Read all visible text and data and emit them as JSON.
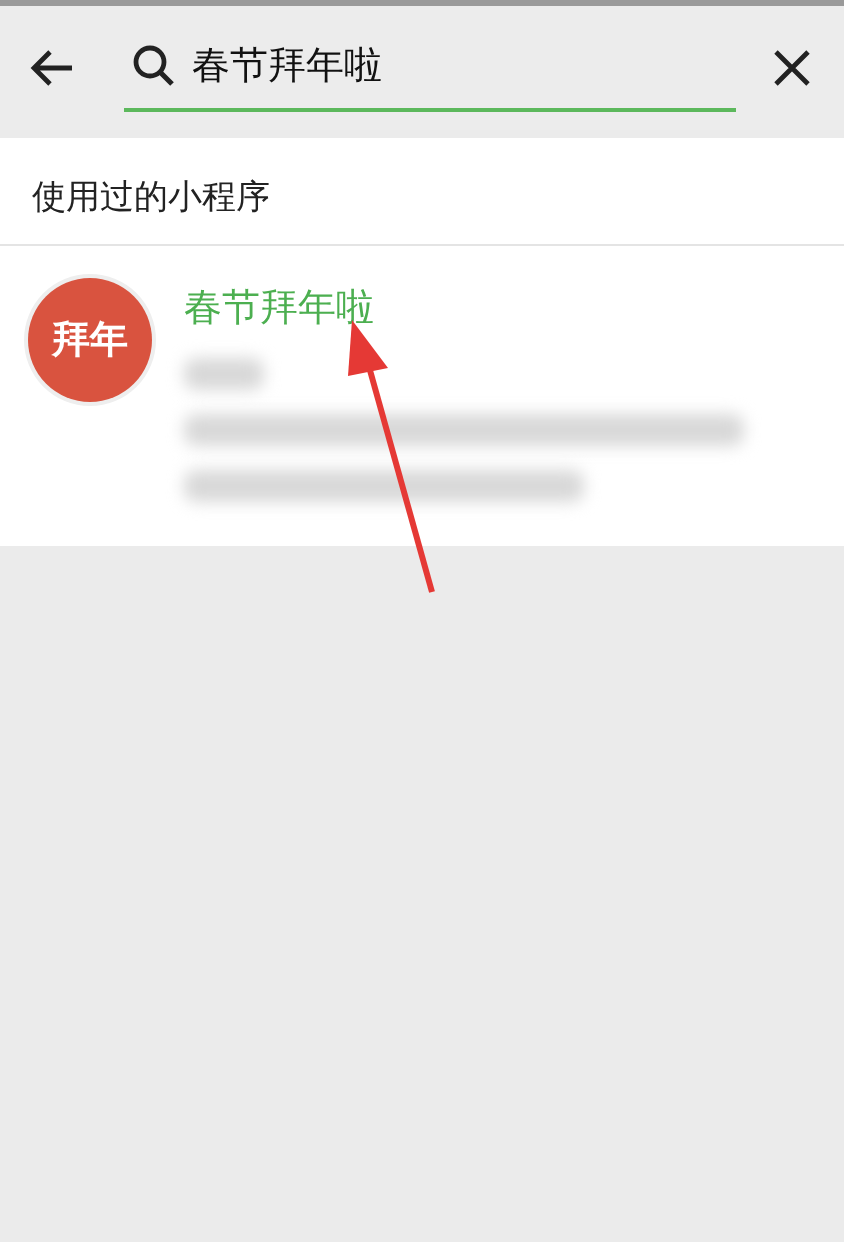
{
  "search": {
    "value": "春节拜年啦"
  },
  "section": {
    "title": "使用过的小程序"
  },
  "results": [
    {
      "logo": "拜年",
      "title": "春节拜年啦"
    }
  ]
}
